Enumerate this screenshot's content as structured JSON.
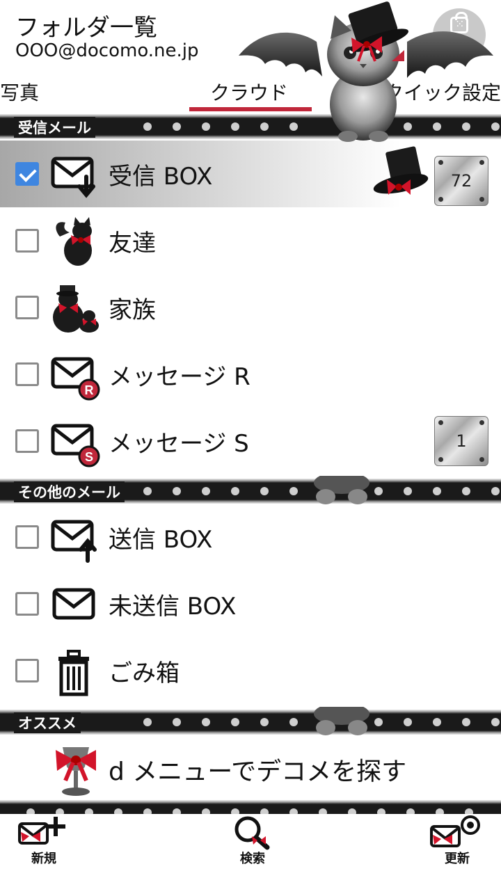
{
  "header": {
    "title": "フォルダ一覧",
    "account": "OOO@docomo.ne.jp",
    "store_label": "ストア"
  },
  "tabs": [
    {
      "label": "写真",
      "active": false
    },
    {
      "label": "クラウド",
      "active": true
    },
    {
      "label": "クイック設定",
      "active": false
    }
  ],
  "sections": {
    "inbox": "受信メール",
    "other": "その他のメール",
    "recommend": "オススメ"
  },
  "folders": [
    {
      "name": "受信 BOX",
      "checked": true,
      "badge": "72",
      "icon": "inbox-envelope-icon"
    },
    {
      "name": "友達",
      "checked": false,
      "badge": "",
      "icon": "cat-friend-icon"
    },
    {
      "name": "家族",
      "checked": false,
      "badge": "",
      "icon": "cat-family-icon"
    },
    {
      "name": "メッセージ R",
      "checked": false,
      "badge": "",
      "icon": "message-r-icon"
    },
    {
      "name": "メッセージ S",
      "checked": false,
      "badge": "1",
      "icon": "message-s-icon"
    }
  ],
  "other_folders": [
    {
      "name": "送信 BOX",
      "checked": false,
      "icon": "outbox-envelope-icon"
    },
    {
      "name": "未送信 BOX",
      "checked": false,
      "icon": "draft-envelope-icon"
    },
    {
      "name": "ごみ箱",
      "checked": false,
      "icon": "trash-icon"
    }
  ],
  "recommend": {
    "text": "d メニューでデコメを探す"
  },
  "bottom_bar": {
    "new_label": "新規",
    "search_label": "検索",
    "refresh_label": "更新"
  },
  "colors": {
    "accent": "#c0273a",
    "checkbox_checked": "#3f86e0",
    "band": "#1a1a1a"
  }
}
